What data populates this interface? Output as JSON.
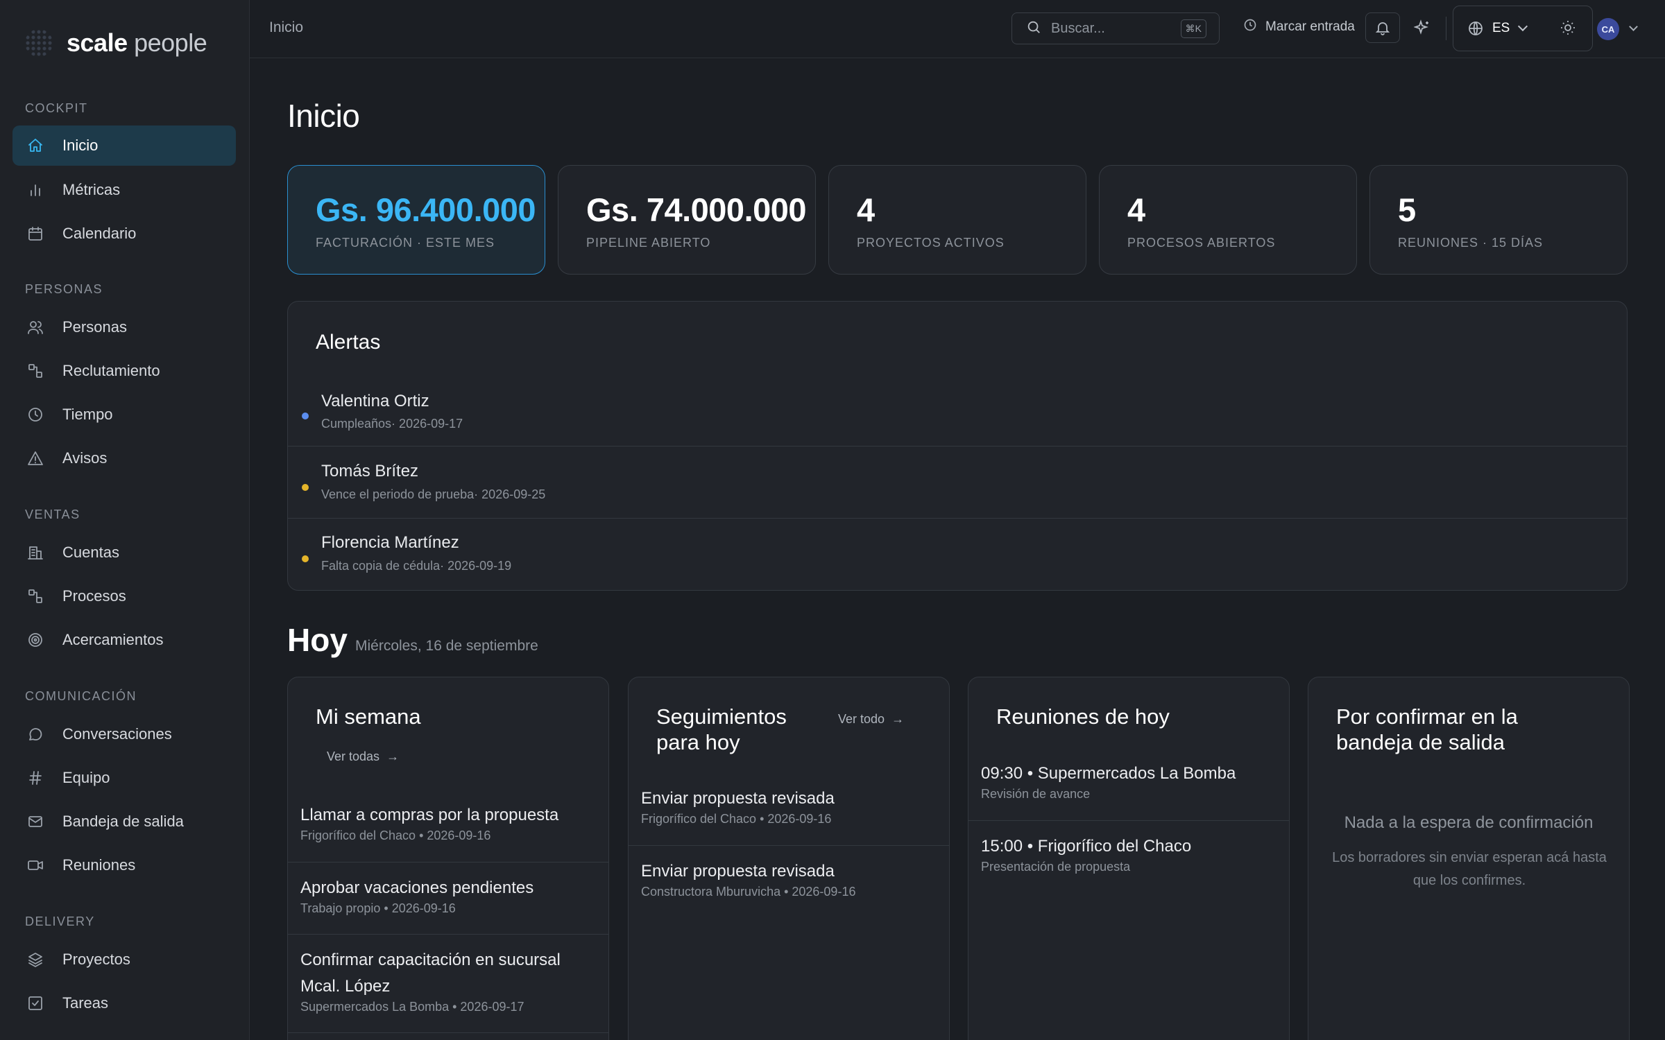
{
  "app": {
    "brand_bold": "scale",
    "brand_light": "people"
  },
  "sidebar": {
    "sections": [
      {
        "label": "COCKPIT",
        "items": [
          {
            "label": "Inicio",
            "icon": "home-icon",
            "active": true
          },
          {
            "label": "Métricas",
            "icon": "bar-chart-icon"
          },
          {
            "label": "Calendario",
            "icon": "calendar-icon"
          }
        ]
      },
      {
        "label": "PERSONAS",
        "items": [
          {
            "label": "Personas",
            "icon": "users-icon"
          },
          {
            "label": "Reclutamiento",
            "icon": "workflow-icon"
          },
          {
            "label": "Tiempo",
            "icon": "clock-icon"
          },
          {
            "label": "Avisos",
            "icon": "warning-icon"
          }
        ]
      },
      {
        "label": "VENTAS",
        "items": [
          {
            "label": "Cuentas",
            "icon": "building-icon"
          },
          {
            "label": "Procesos",
            "icon": "workflow-icon"
          },
          {
            "label": "Acercamientos",
            "icon": "target-icon"
          }
        ]
      },
      {
        "label": "COMUNICACIÓN",
        "items": [
          {
            "label": "Conversaciones",
            "icon": "chat-icon"
          },
          {
            "label": "Equipo",
            "icon": "hash-icon"
          },
          {
            "label": "Bandeja de salida",
            "icon": "mail-icon"
          },
          {
            "label": "Reuniones",
            "icon": "video-icon"
          }
        ]
      },
      {
        "label": "DELIVERY",
        "items": [
          {
            "label": "Proyectos",
            "icon": "layers-icon"
          },
          {
            "label": "Tareas",
            "icon": "checkbox-icon"
          }
        ]
      }
    ]
  },
  "topbar": {
    "breadcrumb": "Inicio",
    "search_placeholder": "Buscar...",
    "search_shortcut": "⌘K",
    "clock_in_label": "Marcar entrada",
    "language": "ES",
    "user_initials": "CA"
  },
  "page": {
    "title": "Inicio"
  },
  "kpis": [
    {
      "value": "Gs. 96.400.000",
      "label": "FACTURACIÓN · ESTE MES",
      "active": true
    },
    {
      "value": "Gs. 74.000.000",
      "label": "PIPELINE ABIERTO"
    },
    {
      "value": "4",
      "label": "PROYECTOS ACTIVOS"
    },
    {
      "value": "4",
      "label": "PROCESOS ABIERTOS"
    },
    {
      "value": "5",
      "label": "REUNIONES · 15 DÍAS"
    }
  ],
  "alerts": {
    "title": "Alertas",
    "items": [
      {
        "name": "Valentina Ortiz",
        "detail": "Cumpleaños· 2026-09-17",
        "color": "#5b8def"
      },
      {
        "name": "Tomás Brítez",
        "detail": "Vence el periodo de prueba· 2026-09-25",
        "color": "#e5b52a"
      },
      {
        "name": "Florencia Martínez",
        "detail": "Falta copia de cédula· 2026-09-19",
        "color": "#e5b52a"
      }
    ]
  },
  "today": {
    "title": "Hoy",
    "date": "Miércoles, 16 de septiembre",
    "week": {
      "title": "Mi semana",
      "link": "Ver todas",
      "items": [
        {
          "title": "Llamar a compras por la propuesta",
          "sub": "Frigorífico del Chaco • 2026-09-16"
        },
        {
          "title": "Aprobar vacaciones pendientes",
          "sub": "Trabajo propio • 2026-09-16"
        },
        {
          "title": "Confirmar capacitación en sucursal Mcal. López",
          "sub": "Supermercados La Bomba • 2026-09-17"
        }
      ]
    },
    "followups": {
      "title": "Seguimientos para hoy",
      "link": "Ver todo",
      "items": [
        {
          "title": "Enviar propuesta revisada",
          "sub": "Frigorífico del Chaco • 2026-09-16"
        },
        {
          "title": "Enviar propuesta revisada",
          "sub": "Constructora Mburuvicha • 2026-09-16"
        }
      ]
    },
    "meetings": {
      "title": "Reuniones de hoy",
      "items": [
        {
          "title": "09:30 • Supermercados La Bomba",
          "sub": "Revisión de avance"
        },
        {
          "title": "15:00 • Frigorífico del Chaco",
          "sub": "Presentación de propuesta"
        }
      ]
    },
    "outbox": {
      "title": "Por confirmar en la bandeja de salida",
      "empty_title": "Nada a la espera de confirmación",
      "empty_text": "Los borradores sin enviar esperan acá hasta que los confirmes."
    }
  }
}
